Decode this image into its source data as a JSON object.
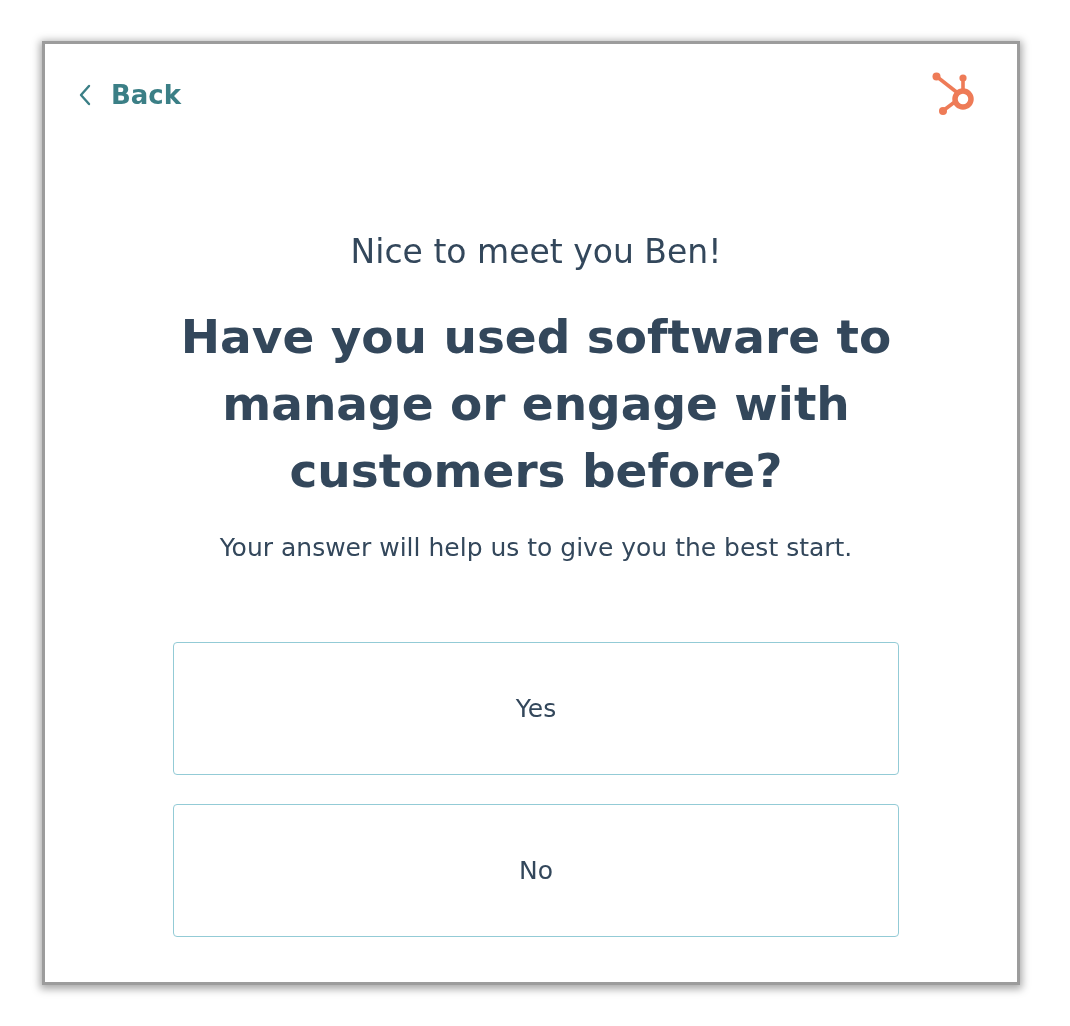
{
  "back": {
    "label": "Back"
  },
  "greeting": "Nice to meet you Ben!",
  "question": "Have you used software to manage or engage with customers before?",
  "hint": "Your answer will help us to give you the best start.",
  "options": [
    {
      "label": "Yes",
      "selected": false
    },
    {
      "label": "No",
      "selected": false
    }
  ]
}
